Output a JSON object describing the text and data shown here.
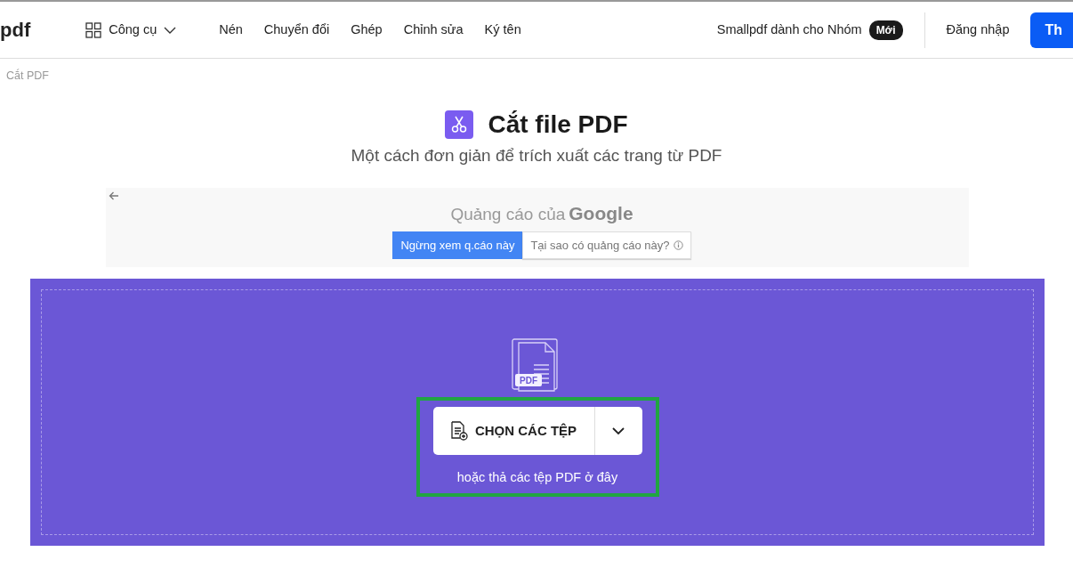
{
  "navbar": {
    "logo": "pdf",
    "tools_menu": "Công cụ",
    "links": [
      "Nén",
      "Chuyển đổi",
      "Ghép",
      "Chỉnh sửa",
      "Ký tên"
    ],
    "teams_link": "Smallpdf dành cho Nhóm",
    "teams_badge": "Mới",
    "login": "Đăng nhập",
    "cta": "Th"
  },
  "breadcrumb": "Cắt PDF",
  "hero": {
    "title": "Cắt file PDF",
    "subtitle": "Một cách đơn giản để trích xuất các trang từ PDF"
  },
  "ad": {
    "label": "Quảng cáo của",
    "brand": "Google",
    "buttons": [
      {
        "label": "Ngừng xem q.cáo này",
        "kind": "primary"
      },
      {
        "label": "Tại sao có quảng cáo này?",
        "kind": "info"
      }
    ]
  },
  "dropzone": {
    "file_badge": "PDF",
    "choose_button": "CHỌN CÁC TỆP",
    "hint": "hoặc thả các tệp PDF ở đây",
    "highlighted": true
  }
}
